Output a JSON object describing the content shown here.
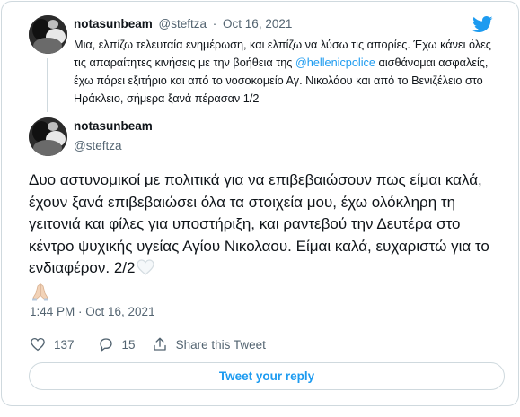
{
  "tweet1": {
    "display_name": "notasunbeam",
    "handle": "@steftza",
    "separator": "·",
    "date": "Oct 16, 2021",
    "text_before_mention": "Μια, ελπίζω τελευταία ενημέρωση, και ελπίζω να λύσω τις απορίες. Έχω κάνει όλες τις απαραίτητες κινήσεις με την βοήθεια της ",
    "mention": "@hellenicpolice",
    "text_after_mention": " αισθάνομαι ασφαλείς, έχω πάρει εξιτήριο και από το νοσοκομείο Αγ. Νικολάου και από το Βενιζέλειο στο Ηράκλειο, σήμερα ξανά πέρασαν 1/2"
  },
  "tweet2": {
    "display_name": "notasunbeam",
    "handle": "@steftza",
    "text": "Δυο αστυνομικοί με πολιτικά για να επιβεβαιώσουν πως είμαι καλά, έχουν ξανά επιβεβαιώσει όλα τα στοιχεία μου, έχω ολόκληρη τη γειτονιά και φίλες για υποστήριξη, και ραντεβού την Δευτέρα στο κέντρο ψυχικής υγείας Αγίου Νικολαου. Είμαι καλά, ευχαριστώ για το ενδιαφέρον. 2/2",
    "emoji_heart": "white-heart",
    "emoji_hands": "folded-hands",
    "timestamp": "1:44 PM · Oct 16, 2021"
  },
  "actions": {
    "like_count": "137",
    "reply_count": "15",
    "share_label": "Share this Tweet"
  },
  "reply_button_label": "Tweet your reply",
  "icons": {
    "brand": "twitter-bird-icon",
    "like": "heart-icon",
    "reply": "reply-bubble-icon",
    "share": "share-icon"
  },
  "colors": {
    "accent": "#1d9bf0",
    "text": "#0f1419",
    "secondary": "#536471",
    "border": "#cfd9de"
  }
}
